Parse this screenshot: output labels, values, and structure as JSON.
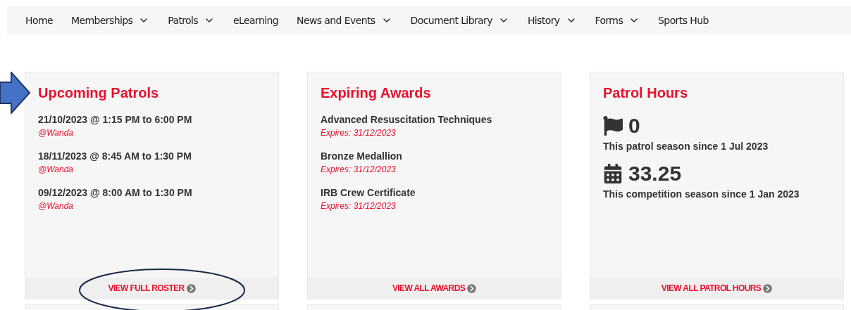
{
  "nav": [
    {
      "label": "Home",
      "dropdown": false
    },
    {
      "label": "Memberships",
      "dropdown": true
    },
    {
      "label": "Patrols",
      "dropdown": true
    },
    {
      "label": "eLearning",
      "dropdown": false
    },
    {
      "label": "News and Events",
      "dropdown": true
    },
    {
      "label": "Document Library",
      "dropdown": true
    },
    {
      "label": "History",
      "dropdown": true
    },
    {
      "label": "Forms",
      "dropdown": true
    },
    {
      "label": "Sports Hub",
      "dropdown": false
    }
  ],
  "cards": [
    {
      "kind": "list",
      "title": "Upcoming Patrols",
      "items": [
        {
          "main": "21/10/2023 @ 1:15 PM to 6:00 PM",
          "sub": "@Wanda"
        },
        {
          "main": "18/11/2023 @ 8:45 AM to 1:30 PM",
          "sub": "@Wanda"
        },
        {
          "main": "09/12/2023 @ 8:00 AM to 1:30 PM",
          "sub": "@Wanda"
        }
      ],
      "link": "VIEW FULL ROSTER",
      "annotated": true
    },
    {
      "kind": "list",
      "title": "Expiring Awards",
      "items": [
        {
          "main": "Advanced Resuscitation Techniques",
          "sub": "Expires: 31/12/2023"
        },
        {
          "main": "Bronze Medallion",
          "sub": "Expires: 31/12/2023"
        },
        {
          "main": "IRB Crew Certificate",
          "sub": "Expires: 31/12/2023"
        }
      ],
      "link": "VIEW ALL AWARDS",
      "annotated": false
    },
    {
      "kind": "stats",
      "title": "Patrol Hours",
      "stats": [
        {
          "value": "0",
          "caption": "This patrol season since 1 Jul 2023"
        },
        {
          "value": "33.25",
          "caption": "This competition season since 1 Jan 2023"
        }
      ],
      "link": "VIEW ALL PATROL HOURS",
      "annotated": false
    }
  ]
}
